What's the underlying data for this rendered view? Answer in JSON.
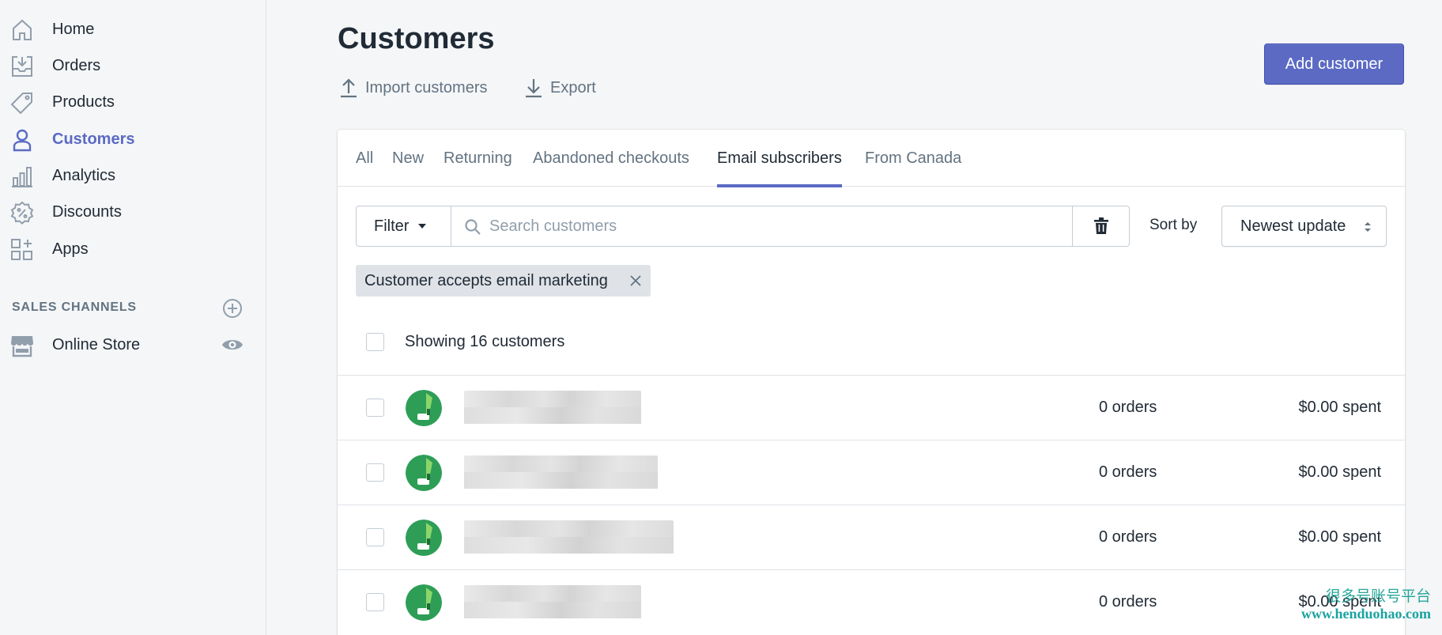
{
  "sidebar": {
    "items": [
      {
        "label": "Home",
        "icon": "home-icon"
      },
      {
        "label": "Orders",
        "icon": "orders-icon"
      },
      {
        "label": "Products",
        "icon": "tag-icon"
      },
      {
        "label": "Customers",
        "icon": "person-icon"
      },
      {
        "label": "Analytics",
        "icon": "bar-chart-icon"
      },
      {
        "label": "Discounts",
        "icon": "discount-icon"
      },
      {
        "label": "Apps",
        "icon": "apps-icon"
      }
    ],
    "active": "Customers",
    "sales_channels_label": "SALES CHANNELS",
    "channel": {
      "label": "Online Store",
      "icon": "store-icon"
    }
  },
  "header": {
    "title": "Customers",
    "import_label": "Import customers",
    "export_label": "Export",
    "add_button_label": "Add customer"
  },
  "tabs": [
    {
      "label": "All"
    },
    {
      "label": "New"
    },
    {
      "label": "Returning"
    },
    {
      "label": "Abandoned checkouts"
    },
    {
      "label": "Email subscribers"
    },
    {
      "label": "From Canada"
    }
  ],
  "active_tab": "Email subscribers",
  "toolbar": {
    "filter_label": "Filter",
    "search_placeholder": "Search customers",
    "sort_label": "Sort by",
    "sort_value": "Newest update"
  },
  "applied_filter": "Customer accepts email marketing",
  "showing_text": "Showing 16 customers",
  "customers": [
    {
      "orders": "0 orders",
      "spent": "$0.00 spent"
    },
    {
      "orders": "0 orders",
      "spent": "$0.00 spent"
    },
    {
      "orders": "0 orders",
      "spent": "$0.00 spent"
    },
    {
      "orders": "0 orders",
      "spent": "$0.00 spent"
    }
  ],
  "watermark": {
    "text": "很多号账号平台",
    "url": "www.henduohao.com"
  },
  "colors": {
    "accent": "#5c6ac4",
    "avatar_green": "#2e9e57",
    "text": "#212b36",
    "muted": "#637381"
  }
}
